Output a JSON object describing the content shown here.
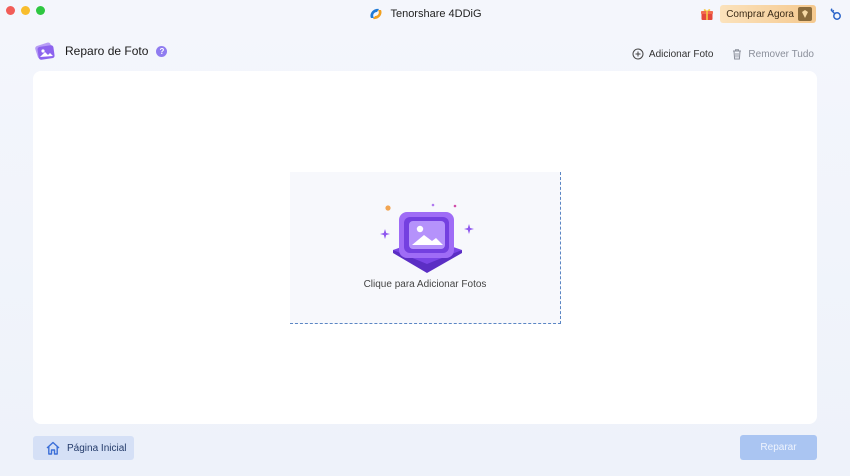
{
  "app": {
    "title": "Tenorshare 4DDiG"
  },
  "titlebar": {
    "buy_label": "Comprar Agora",
    "icons": [
      "close-dot",
      "minimize-dot",
      "zoom-dot",
      "app-logo-icon",
      "gift-icon",
      "diamond-icon",
      "key-icon"
    ]
  },
  "header": {
    "title": "Reparo de Foto",
    "help": "?"
  },
  "actions": {
    "add_label": "Adicionar Foto",
    "remove_label": "Remover Tudo"
  },
  "dropzone": {
    "label": "Clique para Adicionar Fotos"
  },
  "footer": {
    "home_label": "Página Inicial",
    "repair_label": "Reparar"
  },
  "colors": {
    "accent": "#7b5cf0",
    "primary_disabled": "#aac5f2",
    "home_button": "#d5e0f6",
    "dashed_border": "#5b86c4"
  }
}
